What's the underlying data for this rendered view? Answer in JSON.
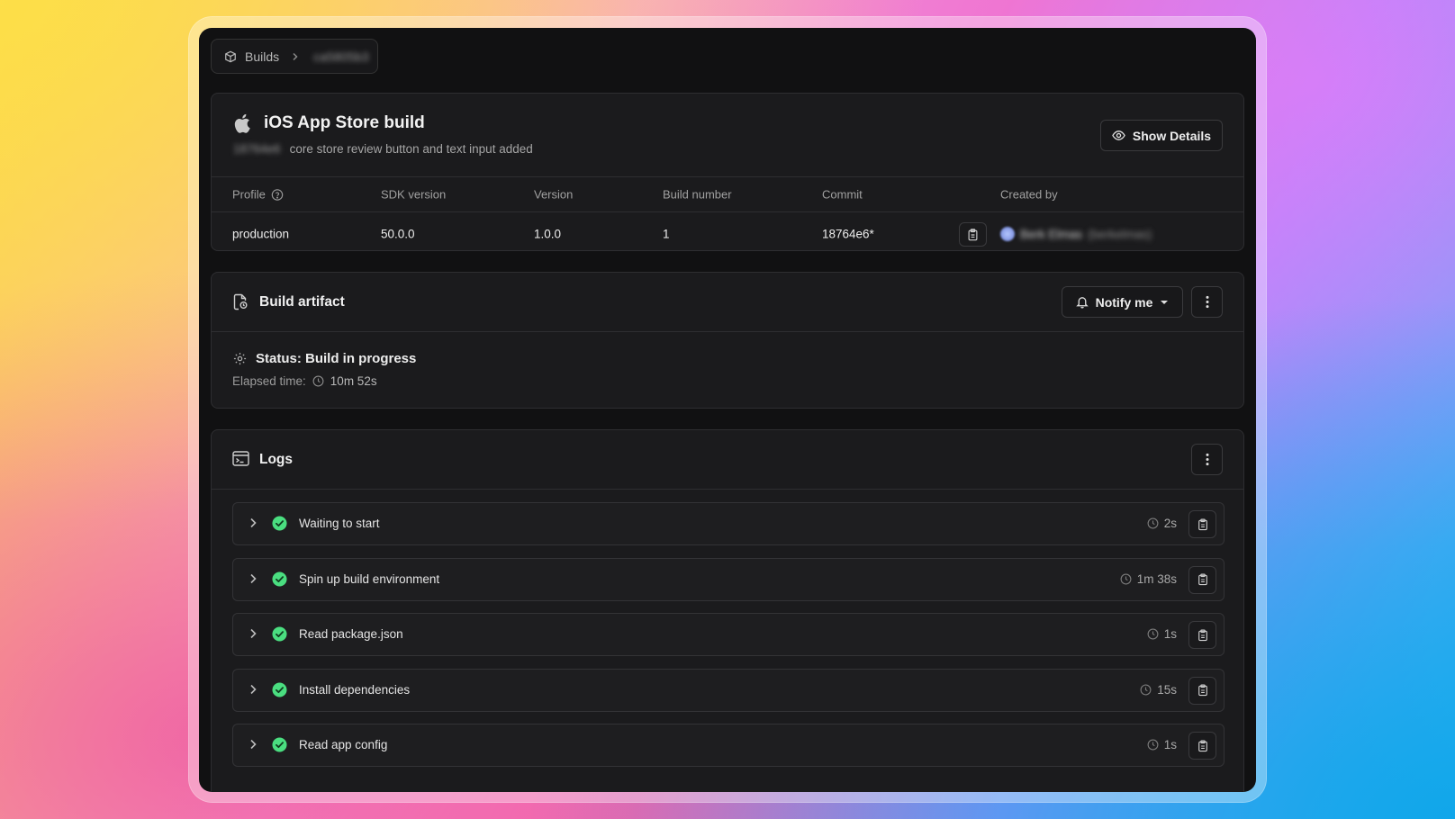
{
  "breadcrumb": {
    "root": "Builds",
    "current": "ca5805b3"
  },
  "build": {
    "title": "iOS App Store build",
    "commit_hash_short": "18764e6",
    "commit_message": "core store review button and text input added",
    "show_details_label": "Show Details"
  },
  "meta_table": {
    "headers": {
      "profile": "Profile",
      "sdk_version": "SDK version",
      "version": "Version",
      "build_number": "Build number",
      "commit": "Commit",
      "created_by": "Created by"
    },
    "values": {
      "profile": "production",
      "sdk_version": "50.0.0",
      "version": "1.0.0",
      "build_number": "1",
      "commit": "18764e6*",
      "created_by_name": "Berk Elmas",
      "created_by_handle": "(berkelmas)"
    }
  },
  "artifact": {
    "title": "Build artifact",
    "notify_label": "Notify me",
    "status_label": "Status: Build in progress",
    "elapsed_label": "Elapsed time:",
    "elapsed_value": "10m 52s"
  },
  "logs": {
    "title": "Logs",
    "steps": [
      {
        "label": "Waiting to start",
        "duration": "2s"
      },
      {
        "label": "Spin up build environment",
        "duration": "1m 38s"
      },
      {
        "label": "Read package.json",
        "duration": "1s"
      },
      {
        "label": "Install dependencies",
        "duration": "15s"
      },
      {
        "label": "Read app config",
        "duration": "1s"
      }
    ]
  },
  "colors": {
    "success": "#4ade80",
    "window_bg": "#111112",
    "card_bg": "#1b1b1d"
  }
}
